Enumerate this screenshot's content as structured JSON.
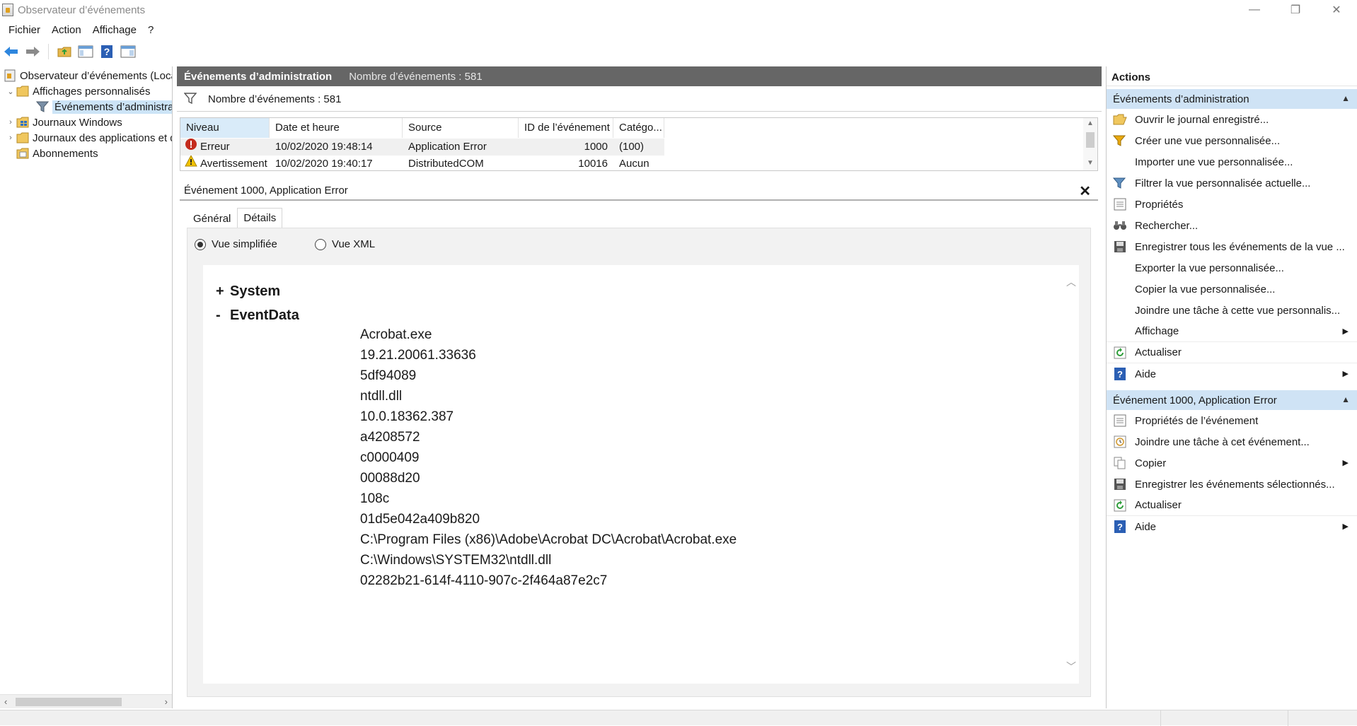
{
  "window": {
    "title": "Observateur d’événements",
    "minimize": "—",
    "restore": "❐",
    "close": "✕"
  },
  "menu": [
    "Fichier",
    "Action",
    "Affichage",
    "?"
  ],
  "tree": {
    "root": "Observateur d’événements (Local)",
    "custom_views": "Affichages personnalisés",
    "admin_events": "Événements d’administration",
    "windows_logs": "Journaux Windows",
    "app_logs": "Journaux des applications et de services",
    "subscriptions": "Abonnements"
  },
  "center": {
    "header_title": "Événements d’administration",
    "header_count": "Nombre d’événements : 581",
    "filter_text": "Nombre d’événements : 581",
    "columns": [
      "Niveau",
      "Date et heure",
      "Source",
      "ID de l’événement",
      "Catégo..."
    ],
    "rows": [
      {
        "level": "Erreur",
        "level_type": "error",
        "datetime": "10/02/2020 19:48:14",
        "source": "Application Error",
        "id": "1000",
        "category": "(100)"
      },
      {
        "level": "Avertissement",
        "level_type": "warning",
        "datetime": "10/02/2020 19:40:17",
        "source": "DistributedCOM",
        "id": "10016",
        "category": "Aucun"
      }
    ],
    "detail_title": "Événement 1000, Application Error",
    "tabs": [
      "Général",
      "Détails"
    ],
    "radio_simple": "Vue simplifiée",
    "radio_xml": "Vue XML",
    "node_system_sign": "+",
    "node_system": "System",
    "node_eventdata_sign": "-",
    "node_eventdata": "EventData",
    "event_data": [
      "Acrobat.exe",
      "19.21.20061.33636",
      "5df94089",
      "ntdll.dll",
      "10.0.18362.387",
      "a4208572",
      "c0000409",
      "00088d20",
      "108c",
      "01d5e042a409b820",
      "C:\\Program Files (x86)\\Adobe\\Acrobat DC\\Acrobat\\Acrobat.exe",
      "C:\\Windows\\SYSTEM32\\ntdll.dll",
      "02282b21-614f-4110-907c-2f464a87e2c7"
    ]
  },
  "actions": {
    "title": "Actions",
    "section1": "Événements d’administration",
    "section1_items": [
      "Ouvrir le journal enregistré...",
      "Créer une vue personnalisée...",
      "Importer une vue personnalisée...",
      "Filtrer la vue personnalisée actuelle...",
      "Propriétés",
      "Rechercher...",
      "Enregistrer tous les événements de la vue ...",
      "Exporter la vue personnalisée...",
      "Copier la vue personnalisée...",
      "Joindre une tâche à cette vue personnalis...",
      "Affichage",
      "Actualiser",
      "Aide"
    ],
    "section2": "Événement 1000, Application Error",
    "section2_items": [
      "Propriétés de l’événement",
      "Joindre une tâche à cet événement...",
      "Copier",
      "Enregistrer les événements sélectionnés...",
      "Actualiser",
      "Aide"
    ]
  },
  "colors": {
    "accent": "#cfe3f5",
    "header_bg": "#666666",
    "error": "#c42b1c",
    "warning": "#f2c200"
  }
}
